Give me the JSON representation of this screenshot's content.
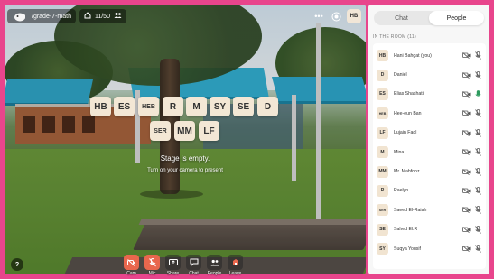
{
  "topbar": {
    "room_name": "/grade-7-math",
    "count": "11/50",
    "user_badge": "HB"
  },
  "stage": {
    "tiles_row1": [
      "HB",
      "ES",
      "HEB",
      "R",
      "M",
      "SY",
      "SE",
      "D"
    ],
    "tiles_row2": [
      "SER",
      "MM",
      "LF"
    ],
    "empty_title": "Stage is empty.",
    "empty_sub": "Turn on your camera to present"
  },
  "controls": [
    {
      "label": "Cam",
      "icon": "camera-off-icon",
      "active_red": true
    },
    {
      "label": "Mic",
      "icon": "mic-off-icon",
      "active_red": true
    },
    {
      "label": "Share",
      "icon": "share-screen-icon",
      "active_red": false
    },
    {
      "label": "Chat",
      "icon": "chat-icon",
      "active_red": false
    },
    {
      "label": "People",
      "icon": "people-icon",
      "active_red": false
    },
    {
      "label": "Leave",
      "icon": "leave-icon",
      "active_red": false
    }
  ],
  "help_label": "?",
  "panel": {
    "tabs": [
      {
        "label": "Chat",
        "active": false
      },
      {
        "label": "People",
        "active": true
      }
    ],
    "room_header": "IN THE ROOM (11)",
    "people": [
      {
        "initials": "HB",
        "name": "Hani Bahgat (you)",
        "mic": "muted"
      },
      {
        "initials": "D",
        "name": "Daniel",
        "mic": "muted"
      },
      {
        "initials": "ES",
        "name": "Elias Shashati",
        "mic": "on"
      },
      {
        "initials": "HEB",
        "name": "Hee-eun Ban",
        "mic": "muted"
      },
      {
        "initials": "LF",
        "name": "Lujain Fadl",
        "mic": "muted"
      },
      {
        "initials": "M",
        "name": "Mina",
        "mic": "muted"
      },
      {
        "initials": "MM",
        "name": "Mr. Mahfooz",
        "mic": "muted"
      },
      {
        "initials": "R",
        "name": "Raelyn",
        "mic": "muted"
      },
      {
        "initials": "SER",
        "name": "Saeed El-Raiah",
        "mic": "muted"
      },
      {
        "initials": "SE",
        "name": "Sahed El.R",
        "mic": "muted"
      },
      {
        "initials": "SY",
        "name": "Suqya Yousif",
        "mic": "muted"
      }
    ]
  },
  "colors": {
    "frame": "#e8458c",
    "tile_bg": "#f3e7d5",
    "control_red": "#e9674d",
    "mic_on": "#2e9b5f"
  }
}
